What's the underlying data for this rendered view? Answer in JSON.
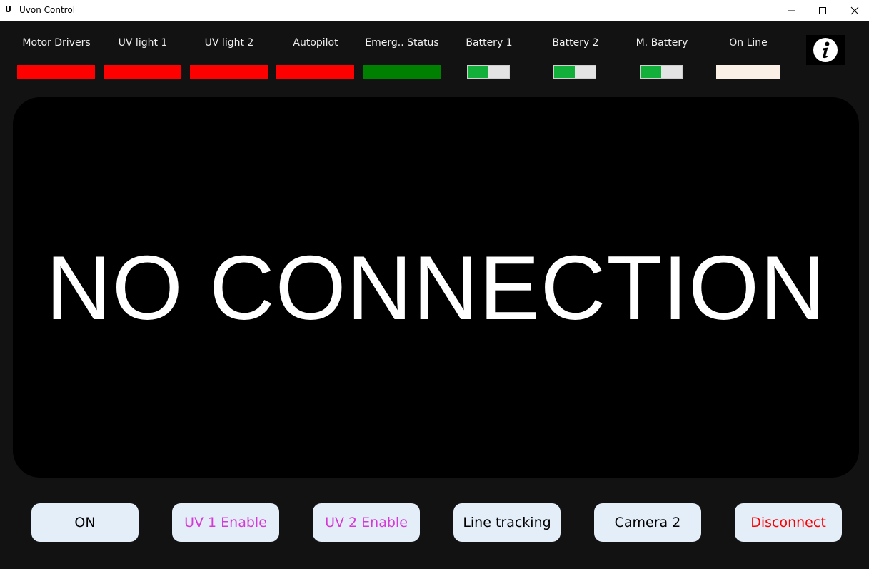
{
  "window": {
    "app_icon_text": "U",
    "title": "Uvon Control",
    "controls": [
      "minimize-icon",
      "maximize-icon",
      "close-icon"
    ]
  },
  "status": {
    "motor_drivers": {
      "label": "Motor Drivers",
      "color": "#ff0000"
    },
    "uv_light_1": {
      "label": "UV light 1",
      "color": "#ff0000"
    },
    "uv_light_2": {
      "label": "UV light 2",
      "color": "#ff0000"
    },
    "autopilot": {
      "label": "Autopilot",
      "color": "#ff0000"
    },
    "emergency": {
      "label": "Emerg.. Status",
      "color": "#008000"
    },
    "battery_1": {
      "label": "Battery 1",
      "level": 0.5,
      "color": "#12b03a"
    },
    "battery_2": {
      "label": "Battery 2",
      "level": 0.5,
      "color": "#12b03a"
    },
    "main_battery": {
      "label": "M. Battery",
      "level": 0.5,
      "color": "#12b03a"
    },
    "online": {
      "label": "On Line",
      "color": "#faf0e6"
    }
  },
  "info_button": {
    "icon": "info-icon"
  },
  "display": {
    "message": "NO CONNECTION"
  },
  "buttons": {
    "on": {
      "label": "ON",
      "color": "#000000"
    },
    "uv1_enable": {
      "label": "UV 1 Enable",
      "color": "#d63ad6"
    },
    "uv2_enable": {
      "label": "UV 2 Enable",
      "color": "#d63ad6"
    },
    "line_tracking": {
      "label": "Line tracking",
      "color": "#000000"
    },
    "camera_2": {
      "label": "Camera 2",
      "color": "#000000"
    },
    "disconnect": {
      "label": "Disconnect",
      "color": "#ff0000"
    }
  }
}
